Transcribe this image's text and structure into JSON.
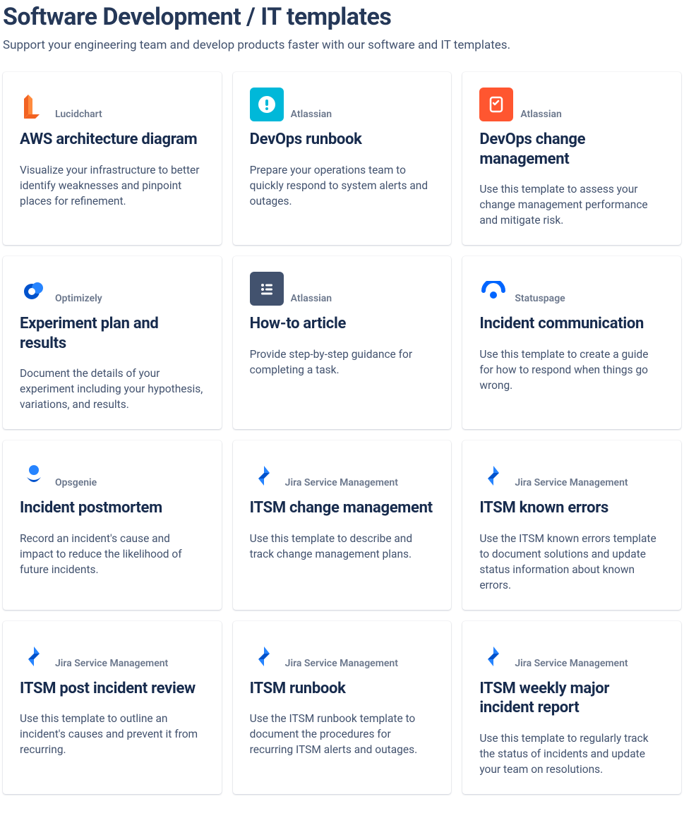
{
  "page": {
    "title": "Software Development / IT templates",
    "subtitle": "Support your engineering team and develop products faster with our software and IT templates."
  },
  "cards": [
    {
      "vendor": "Lucidchart",
      "title": "AWS architecture diagram",
      "desc": "Visualize your infrastructure to better identify weaknesses and pinpoint places for refinement.",
      "icon": "lucidchart"
    },
    {
      "vendor": "Atlassian",
      "title": "DevOps runbook",
      "desc": "Prepare your operations team to quickly respond to system alerts and outages.",
      "icon": "alert-teal"
    },
    {
      "vendor": "Atlassian",
      "title": "DevOps change management",
      "desc": "Use this template to assess your change management performance and mitigate risk.",
      "icon": "checklist-orange"
    },
    {
      "vendor": "Optimizely",
      "title": "Experiment plan and results",
      "desc": "Document the details of your experiment including your hypothesis, variations, and results.",
      "icon": "optimizely"
    },
    {
      "vendor": "Atlassian",
      "title": "How-to article",
      "desc": "Provide step-by-step guidance for completing a task.",
      "icon": "howto-gray"
    },
    {
      "vendor": "Statuspage",
      "title": "Incident communication",
      "desc": "Use this template to create a guide for how to respond when things go wrong.",
      "icon": "statuspage"
    },
    {
      "vendor": "Opsgenie",
      "title": "Incident postmortem",
      "desc": "Record an incident's cause and impact to reduce the likelihood of future incidents.",
      "icon": "opsgenie"
    },
    {
      "vendor": "Jira Service Management",
      "title": "ITSM change management",
      "desc": "Use this template to describe and track change management plans.",
      "icon": "jsm"
    },
    {
      "vendor": "Jira Service Management",
      "title": "ITSM known errors",
      "desc": "Use the ITSM known errors template to document solutions and update status information about known errors.",
      "icon": "jsm"
    },
    {
      "vendor": "Jira Service Management",
      "title": "ITSM post incident review",
      "desc": "Use this template to outline an incident's causes and prevent it from recurring.",
      "icon": "jsm"
    },
    {
      "vendor": "Jira Service Management",
      "title": "ITSM runbook",
      "desc": "Use the ITSM runbook template to document the procedures for recurring ITSM alerts and outages.",
      "icon": "jsm"
    },
    {
      "vendor": "Jira Service Management",
      "title": "ITSM weekly major incident report",
      "desc": "Use this template to regularly track the status of incidents and update your team on resolutions.",
      "icon": "jsm"
    }
  ]
}
